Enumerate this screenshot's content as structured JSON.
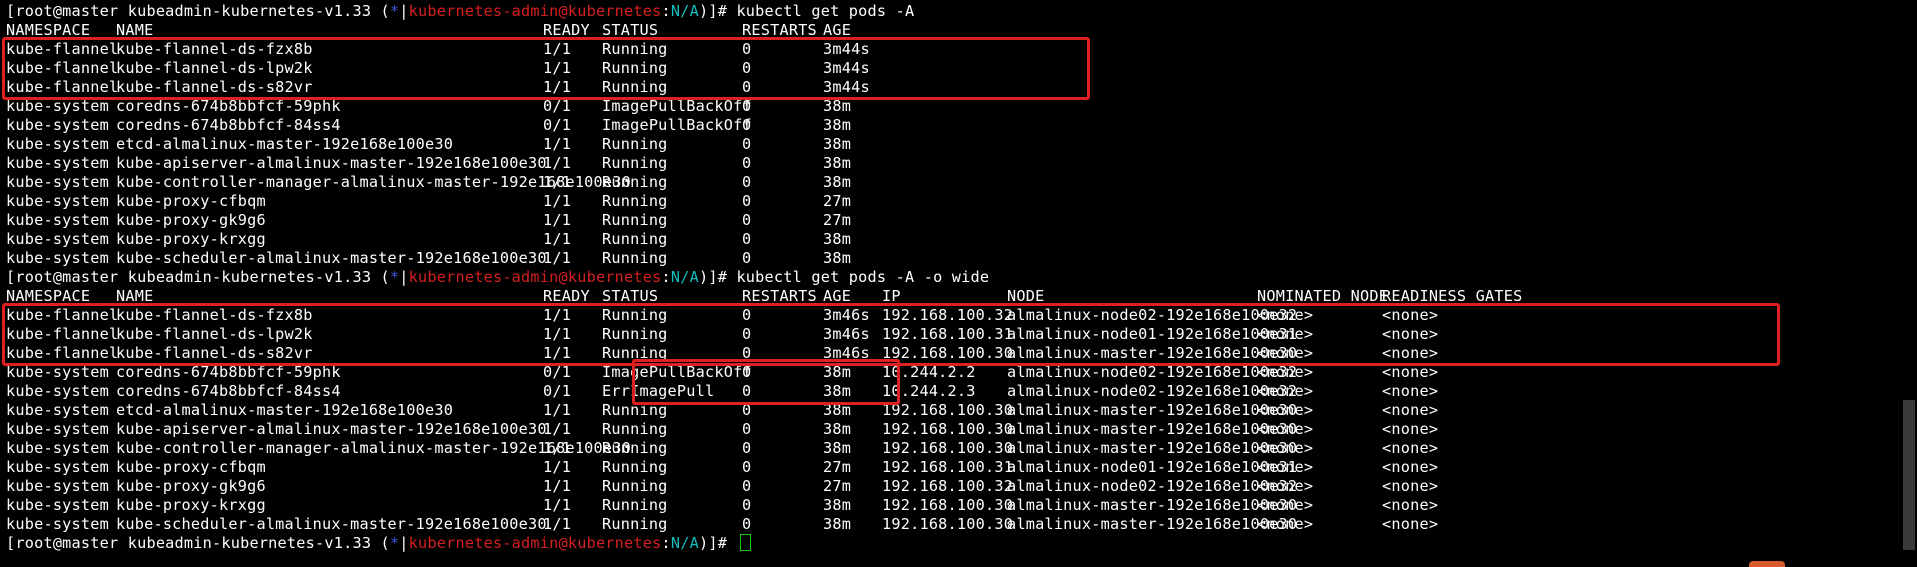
{
  "prompt": {
    "user_host": "[root@master kubeadmin-kubernetes-v1.33 (",
    "star": "*",
    "sep": "|",
    "context": "kubernetes-admin@kubernetes",
    "colon": ":",
    "namespace": "N/A",
    "tail": ")]# "
  },
  "commands": [
    "kubectl get pods -A",
    "kubectl get pods -A -o wide",
    ""
  ],
  "headers": {
    "namespace": "NAMESPACE",
    "name": "NAME",
    "ready": "READY",
    "status": "STATUS",
    "restarts": "RESTARTS",
    "age": "AGE",
    "ip": "IP",
    "node": "NODE",
    "nominated": "NOMINATED NODE",
    "gates": "READINESS GATES"
  },
  "table1": [
    [
      "kube-flannel",
      "kube-flannel-ds-fzx8b",
      "1/1",
      "Running",
      "0",
      "3m44s"
    ],
    [
      "kube-flannel",
      "kube-flannel-ds-lpw2k",
      "1/1",
      "Running",
      "0",
      "3m44s"
    ],
    [
      "kube-flannel",
      "kube-flannel-ds-s82vr",
      "1/1",
      "Running",
      "0",
      "3m44s"
    ],
    [
      "kube-system",
      "coredns-674b8bbfcf-59phk",
      "0/1",
      "ImagePullBackOff",
      "0",
      "38m"
    ],
    [
      "kube-system",
      "coredns-674b8bbfcf-84ss4",
      "0/1",
      "ImagePullBackOff",
      "0",
      "38m"
    ],
    [
      "kube-system",
      "etcd-almalinux-master-192e168e100e30",
      "1/1",
      "Running",
      "0",
      "38m"
    ],
    [
      "kube-system",
      "kube-apiserver-almalinux-master-192e168e100e30",
      "1/1",
      "Running",
      "0",
      "38m"
    ],
    [
      "kube-system",
      "kube-controller-manager-almalinux-master-192e168e100e30",
      "1/1",
      "Running",
      "0",
      "38m"
    ],
    [
      "kube-system",
      "kube-proxy-cfbqm",
      "1/1",
      "Running",
      "0",
      "27m"
    ],
    [
      "kube-system",
      "kube-proxy-gk9g6",
      "1/1",
      "Running",
      "0",
      "27m"
    ],
    [
      "kube-system",
      "kube-proxy-krxgg",
      "1/1",
      "Running",
      "0",
      "38m"
    ],
    [
      "kube-system",
      "kube-scheduler-almalinux-master-192e168e100e30",
      "1/1",
      "Running",
      "0",
      "38m"
    ]
  ],
  "table2": [
    [
      "kube-flannel",
      "kube-flannel-ds-fzx8b",
      "1/1",
      "Running",
      "0",
      "3m46s",
      "192.168.100.32",
      "almalinux-node02-192e168e100e32",
      "<none>",
      "<none>"
    ],
    [
      "kube-flannel",
      "kube-flannel-ds-lpw2k",
      "1/1",
      "Running",
      "0",
      "3m46s",
      "192.168.100.31",
      "almalinux-node01-192e168e100e31",
      "<none>",
      "<none>"
    ],
    [
      "kube-flannel",
      "kube-flannel-ds-s82vr",
      "1/1",
      "Running",
      "0",
      "3m46s",
      "192.168.100.30",
      "almalinux-master-192e168e100e30",
      "<none>",
      "<none>"
    ],
    [
      "kube-system",
      "coredns-674b8bbfcf-59phk",
      "0/1",
      "ImagePullBackOff",
      "0",
      "38m",
      "10.244.2.2",
      "almalinux-node02-192e168e100e32",
      "<none>",
      "<none>"
    ],
    [
      "kube-system",
      "coredns-674b8bbfcf-84ss4",
      "0/1",
      "ErrImagePull",
      "0",
      "38m",
      "10.244.2.3",
      "almalinux-node02-192e168e100e32",
      "<none>",
      "<none>"
    ],
    [
      "kube-system",
      "etcd-almalinux-master-192e168e100e30",
      "1/1",
      "Running",
      "0",
      "38m",
      "192.168.100.30",
      "almalinux-master-192e168e100e30",
      "<none>",
      "<none>"
    ],
    [
      "kube-system",
      "kube-apiserver-almalinux-master-192e168e100e30",
      "1/1",
      "Running",
      "0",
      "38m",
      "192.168.100.30",
      "almalinux-master-192e168e100e30",
      "<none>",
      "<none>"
    ],
    [
      "kube-system",
      "kube-controller-manager-almalinux-master-192e168e100e30",
      "1/1",
      "Running",
      "0",
      "38m",
      "192.168.100.30",
      "almalinux-master-192e168e100e30",
      "<none>",
      "<none>"
    ],
    [
      "kube-system",
      "kube-proxy-cfbqm",
      "1/1",
      "Running",
      "0",
      "27m",
      "192.168.100.31",
      "almalinux-node01-192e168e100e31",
      "<none>",
      "<none>"
    ],
    [
      "kube-system",
      "kube-proxy-gk9g6",
      "1/1",
      "Running",
      "0",
      "27m",
      "192.168.100.32",
      "almalinux-node02-192e168e100e32",
      "<none>",
      "<none>"
    ],
    [
      "kube-system",
      "kube-proxy-krxgg",
      "1/1",
      "Running",
      "0",
      "38m",
      "192.168.100.30",
      "almalinux-master-192e168e100e30",
      "<none>",
      "<none>"
    ],
    [
      "kube-system",
      "kube-scheduler-almalinux-master-192e168e100e30",
      "1/1",
      "Running",
      "0",
      "38m",
      "192.168.100.30",
      "almalinux-master-192e168e100e30",
      "<none>",
      "<none>"
    ]
  ],
  "colors": {
    "background": "#000000",
    "text": "#ffffff",
    "context": "#d42020",
    "namespace": "#10bcbc",
    "star": "#3b5bdb",
    "cursor": "#18c818",
    "annotation": "#e02020"
  }
}
